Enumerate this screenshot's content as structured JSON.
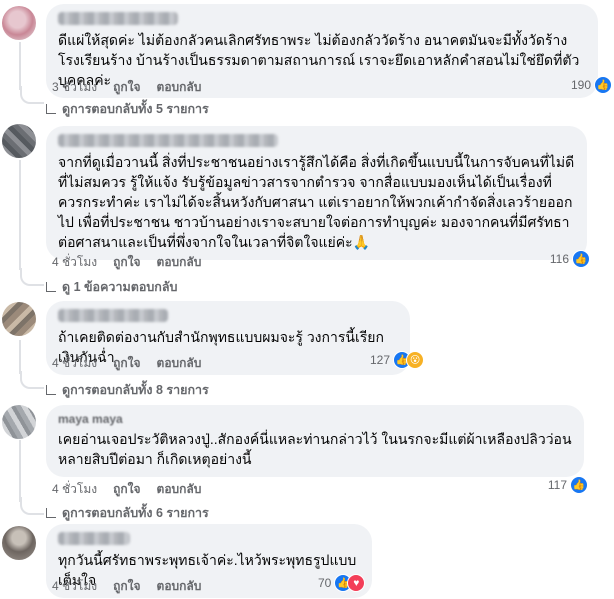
{
  "actions": {
    "like": "ถูกใจ",
    "reply": "ตอบกลับ"
  },
  "reaction_icons": {
    "like": "thumbs-up-icon",
    "wow": "wow-face-icon",
    "love": "heart-icon"
  },
  "colors": {
    "like": "#1877f2",
    "wow": "#f7b125",
    "love": "#f33e58",
    "bubble": "#f0f2f5"
  },
  "comments": [
    {
      "text": "ดีแผ่ให้สุดค่ะ ไม่ต้องกลัวคนเลิกศรัทธาพระ ไม่ต้องกลัววัดร้าง อนาคตมันจะมีทั้งวัดร้าง โรงเรียนร้าง บ้านร้างเป็นธรรมดาตามสถานการณ์ เราจะยึดเอาหลักคำสอนไม่ใช่ยึดที่ตัวบุคคลค่ะ",
      "time": "3 ชั่วโมง",
      "reactions_count": "190",
      "replies": "ดูการตอบกลับทั้ง 5 รายการ"
    },
    {
      "text": "จากที่ดูเมื่อวานนี้ สิ่งที่ประชาชนอย่างเรารู้สึกได้คือ สิ่งที่เกิดขึ้นแบบนี้ในการจับคนที่ไม่ดี ที่ไม่สมควร รู้ให้แจ้ง รับรู้ข้อมูลข่าวสารจากตำรวจ จากสื่อแบบมองเห็นได้เป็นเรื่องที่ควรกระทำค่ะ เราไม่ได้จะสิ้นหวังกับศาสนา แต่เราอยากให้พวกเค้ากำจัดสิ่งเลวร้ายออกไป เพื่อที่ประชาชน ชาวบ้านอย่างเราจะสบายใจต่อการทำบุญค่ะ มองจากคนที่มีศรัทธาต่อศาสนาและเป็นที่พึ่งจากใจในเวลาที่จิตใจแย่ค่ะ🙏",
      "time": "4 ชั่วโมง",
      "reactions_count": "116",
      "replies": "ดู 1 ข้อความตอบกลับ"
    },
    {
      "text": "ถ้าเคยติดต่องานกับสำนักพุทธแบบผมจะรู้ วงการนี้เรียกเงินกันฉ่ำ",
      "time": "4 ชั่วโมง",
      "reactions_count": "127",
      "replies": "ดูการตอบกลับทั้ง 8 รายการ"
    },
    {
      "author": "maya maya",
      "text": "เคยอ่านเจอประวัติหลวงปู่..สักองค์นี่แหละท่านกล่าวไว้ ในนรกจะมีแต่ผ้าเหลืองปลิวว่อน หลายสิบปีต่อมา ก็เกิดเหตุอย่างนี้",
      "time": "4 ชั่วโมง",
      "reactions_count": "117",
      "replies": "ดูการตอบกลับทั้ง 6 รายการ"
    },
    {
      "text": "ทุกวันนี้ศรัทธาพระพุทธเจ้าค่ะ.ไหว้พระพุทธรูปแบบเต็มใจ",
      "time": "4 ชั่วโมง",
      "reactions_count": "70"
    }
  ]
}
